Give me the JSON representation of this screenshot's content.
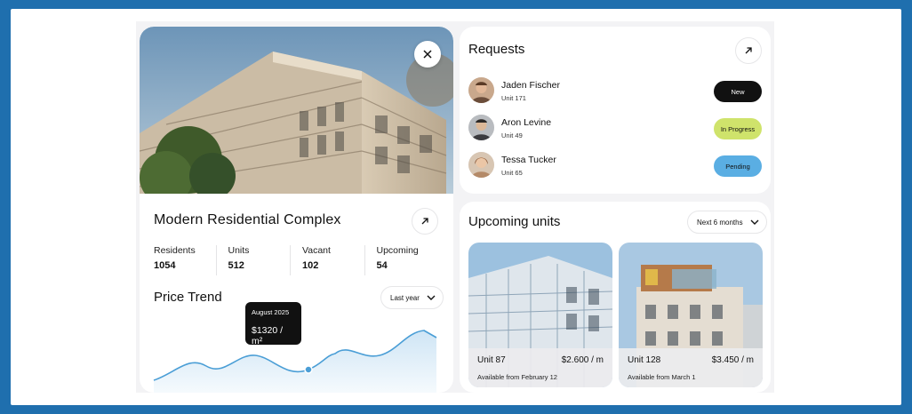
{
  "building": {
    "name": "Modern Residential Complex",
    "stats": [
      {
        "label": "Residents",
        "value": "1054"
      },
      {
        "label": "Units",
        "value": "512"
      },
      {
        "label": "Vacant",
        "value": "102"
      },
      {
        "label": "Upcoming",
        "value": "54"
      }
    ]
  },
  "price_trend": {
    "title": "Price Trend",
    "period": "Last year",
    "tooltip_date": "August 2025",
    "tooltip_value": "$1320 / m²"
  },
  "requests": {
    "title": "Requests",
    "items": [
      {
        "name": "Jaden Fischer",
        "unit": "Unit 171",
        "status": "New"
      },
      {
        "name": "Aron Levine",
        "unit": "Unit 49",
        "status": "In Progress"
      },
      {
        "name": "Tessa Tucker",
        "unit": "Unit 65",
        "status": "Pending"
      }
    ]
  },
  "upcoming": {
    "title": "Upcoming units",
    "period": "Next 6 months",
    "units": [
      {
        "name": "Unit 87",
        "price": "$2.600 / m",
        "available": "Available from February 12"
      },
      {
        "name": "Unit 128",
        "price": "$3.450 / m",
        "available": "Available from March 1"
      }
    ]
  },
  "colors": {
    "frame": "#1f6fae",
    "badge_new": "#111111",
    "badge_in_progress": "#cfe36b",
    "badge_pending": "#5aaee3",
    "trend_line": "#4a9ed6"
  },
  "icons": [
    "close-icon",
    "arrow-up-right-icon",
    "chevron-down-icon"
  ]
}
